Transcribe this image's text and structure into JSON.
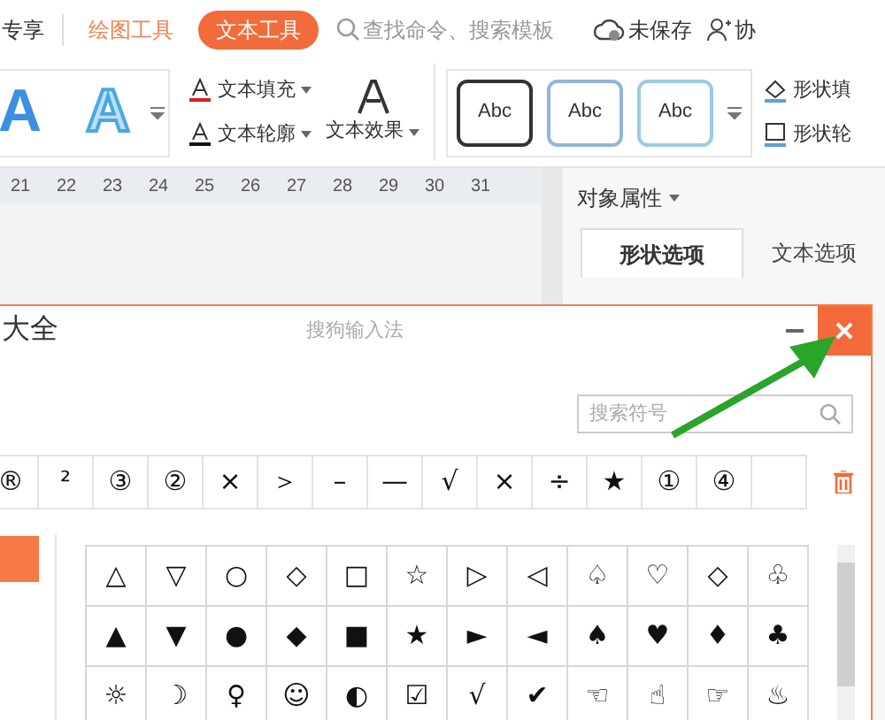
{
  "topbar": {
    "share": "专享",
    "tabs": [
      {
        "label": "绘图工具",
        "selected": false
      },
      {
        "label": "文本工具",
        "selected": true
      }
    ],
    "search": {
      "placeholder": "查找命令、搜索模板"
    },
    "save_status": "未保存",
    "collab": "协"
  },
  "ribbon": {
    "presets": [
      "A",
      "A"
    ],
    "text_fill": "文本填充",
    "text_outline": "文本轮廓",
    "text_effect": "文本效果",
    "styles": [
      "Abc",
      "Abc",
      "Abc"
    ],
    "shape_fill": "形状填",
    "shape_outline": "形状轮"
  },
  "ruler": [
    "21",
    "22",
    "23",
    "24",
    "25",
    "26",
    "27",
    "28",
    "29",
    "30",
    "31"
  ],
  "panel": {
    "title": "对象属性",
    "tabs": [
      {
        "label": "形状选项",
        "selected": true
      },
      {
        "label": "文本选项",
        "selected": false
      }
    ]
  },
  "dialog": {
    "title": "大全",
    "app": "搜狗输入法",
    "search": {
      "placeholder": "搜索符号"
    },
    "recent": [
      "®",
      "²",
      "③",
      "②",
      "×",
      "＞",
      "–",
      "—",
      "√",
      "×",
      "÷",
      "★",
      "①",
      "④"
    ],
    "grid": [
      [
        "△",
        "▽",
        "○",
        "◇",
        "□",
        "☆",
        "▷",
        "◁",
        "♤",
        "♡",
        "◇",
        "♧"
      ],
      [
        "▲",
        "▼",
        "●",
        "◆",
        "■",
        "★",
        "►",
        "◄",
        "♠",
        "♥",
        "♦",
        "♣"
      ],
      [
        "☼",
        "☽",
        "♀",
        "☺",
        "◐",
        "☑",
        "√",
        "✔",
        "☜",
        "☝",
        "☞",
        "♨"
      ]
    ]
  }
}
